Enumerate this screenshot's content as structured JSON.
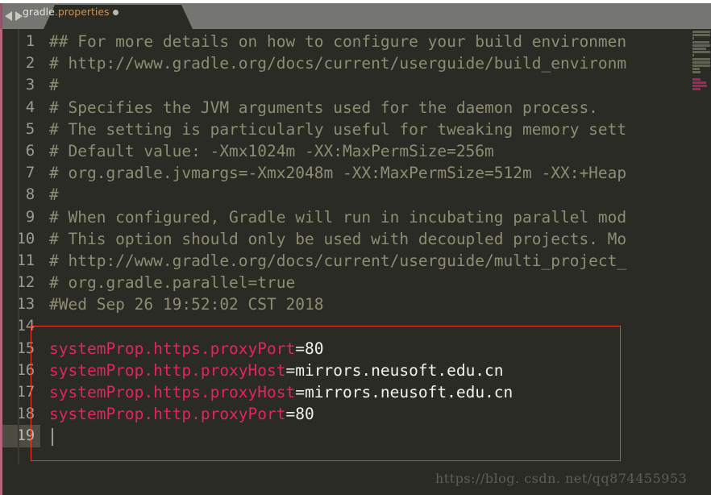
{
  "window": {
    "title": "gradle.properties"
  },
  "tabbar": {
    "nav_back_icon": "triangle-left-icon",
    "nav_forward_icon": "triangle-right-icon",
    "tab_name_prefix": "gradle",
    "tab_name_suffix": ".properties",
    "modified_indicator": "●"
  },
  "editor": {
    "active_line": 19,
    "lines": [
      {
        "num": "1",
        "type": "comment",
        "text": "## For more details on how to configure your build environmen"
      },
      {
        "num": "2",
        "type": "comment",
        "text": "# http://www.gradle.org/docs/current/userguide/build_environm"
      },
      {
        "num": "3",
        "type": "comment",
        "text": "#"
      },
      {
        "num": "4",
        "type": "comment",
        "text": "# Specifies the JVM arguments used for the daemon process."
      },
      {
        "num": "5",
        "type": "comment",
        "text": "# The setting is particularly useful for tweaking memory sett"
      },
      {
        "num": "6",
        "type": "comment",
        "text": "# Default value: -Xmx1024m -XX:MaxPermSize=256m"
      },
      {
        "num": "7",
        "type": "comment",
        "text": "# org.gradle.jvmargs=-Xmx2048m -XX:MaxPermSize=512m -XX:+Heap"
      },
      {
        "num": "8",
        "type": "comment",
        "text": "#"
      },
      {
        "num": "9",
        "type": "comment",
        "text": "# When configured, Gradle will run in incubating parallel mod"
      },
      {
        "num": "10",
        "type": "comment",
        "text": "# This option should only be used with decoupled projects. Mo"
      },
      {
        "num": "11",
        "type": "comment",
        "text": "# http://www.gradle.org/docs/current/userguide/multi_project_"
      },
      {
        "num": "12",
        "type": "comment",
        "text": "# org.gradle.parallel=true"
      },
      {
        "num": "13",
        "type": "comment",
        "text": "#Wed Sep 26 19:52:02 CST 2018"
      },
      {
        "num": "14",
        "type": "blank",
        "text": ""
      },
      {
        "num": "15",
        "type": "property",
        "key": "systemProp.https.proxyPort",
        "eq": "=",
        "value": "80"
      },
      {
        "num": "16",
        "type": "property",
        "key": "systemProp.http.proxyHost",
        "eq": "=",
        "value": "mirrors.neusoft.edu.cn"
      },
      {
        "num": "17",
        "type": "property",
        "key": "systemProp.https.proxyHost",
        "eq": "=",
        "value": "mirrors.neusoft.edu.cn"
      },
      {
        "num": "18",
        "type": "property",
        "key": "systemProp.http.proxyPort",
        "eq": "=",
        "value": "80"
      },
      {
        "num": "19",
        "type": "blank",
        "text": ""
      }
    ]
  },
  "annotation": {
    "highlight_box_color": "#ef3b2a",
    "highlight_lines": [
      15,
      16,
      17,
      18
    ]
  },
  "minimap": {
    "label": "code-minimap",
    "highlight_color": "#a5255a"
  },
  "watermark": {
    "text": "https://blog. csdn. net/qq874455953"
  },
  "colors": {
    "editor_background": "#2b2b26",
    "tabbar_background": "#757571",
    "comment": "#8d8d73",
    "property_key": "#e4245f",
    "property_value": "#f2f2ec",
    "line_number": "#9a9a90",
    "active_line_gutter": "#4c4c42",
    "left_stripe": "#b5647e"
  }
}
